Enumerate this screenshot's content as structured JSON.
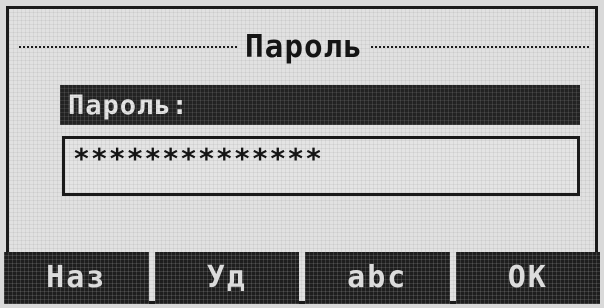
{
  "header": {
    "title": "Пароль"
  },
  "form": {
    "label": "Пароль:",
    "password_value": "**************"
  },
  "softkeys": [
    {
      "label": "Наз"
    },
    {
      "label": "Уд"
    },
    {
      "label": "abc"
    },
    {
      "label": "OK"
    }
  ]
}
